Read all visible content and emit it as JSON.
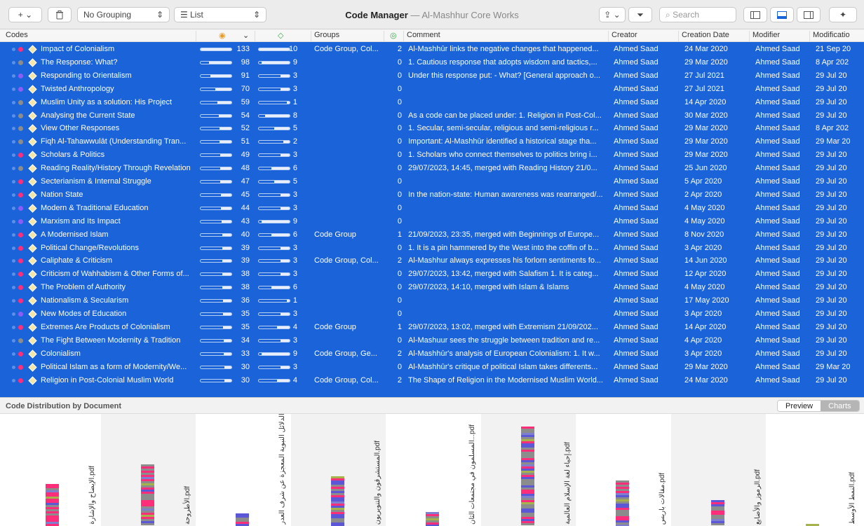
{
  "toolbar": {
    "add_label": "+",
    "grouping_label": "No Grouping",
    "view_label": "List",
    "title": "Code Manager",
    "subtitle": "— Al-Mashhur Core Works",
    "search_placeholder": "Search"
  },
  "columns": {
    "codes": "Codes",
    "groups": "Groups",
    "comment": "Comment",
    "creator": "Creator",
    "creation_date": "Creation Date",
    "modifier": "Modifier",
    "modification": "Modificatio"
  },
  "colors": {
    "selection": "#1a63d8",
    "pink": "#ff2d7a",
    "gray": "#8c8c8c",
    "blue": "#5b57d6",
    "purple": "#8b5cf6"
  },
  "rows": [
    {
      "name": "Impact of Colonialism",
      "dot": "pink",
      "g": 133,
      "d": 10,
      "groups": "Code Group, Col...",
      "gc": "2",
      "comment": "Al-Mashhūr links the negative changes that happened...",
      "creator": "Ahmed Saad",
      "created": "24 Mar 2020",
      "modifier": "Ahmed Saad",
      "modified": "21 Sep 20"
    },
    {
      "name": "The Response: What?",
      "dot": "gray",
      "g": 98,
      "d": 9,
      "groups": "",
      "gc": "0",
      "comment": "1. Cautious response that adopts wisdom and tactics,...",
      "creator": "Ahmed Saad",
      "created": "29 Mar 2020",
      "modifier": "Ahmed Saad",
      "modified": "8 Apr 202"
    },
    {
      "name": "Responding to Orientalism",
      "dot": "purple",
      "g": 91,
      "d": 3,
      "groups": "",
      "gc": "0",
      "comment": "Under this response put: - What? [General approach o...",
      "creator": "Ahmed Saad",
      "created": "27 Jul 2021",
      "modifier": "Ahmed Saad",
      "modified": "29 Jul 20"
    },
    {
      "name": "Twisted Anthropology",
      "dot": "purple",
      "g": 70,
      "d": 3,
      "groups": "",
      "gc": "0",
      "comment": "",
      "creator": "Ahmed Saad",
      "created": "27 Jul 2021",
      "modifier": "Ahmed Saad",
      "modified": "29 Jul 20"
    },
    {
      "name": "Muslim Unity as a solution: His Project",
      "dot": "gray",
      "g": 59,
      "d": 1,
      "groups": "",
      "gc": "0",
      "comment": "",
      "creator": "Ahmed Saad",
      "created": "14 Apr 2020",
      "modifier": "Ahmed Saad",
      "modified": "29 Jul 20"
    },
    {
      "name": "Analysing the Current State",
      "dot": "gray",
      "g": 54,
      "d": 8,
      "groups": "",
      "gc": "0",
      "comment": "As a code can be placed under: 1. Religion in Post-Col...",
      "creator": "Ahmed Saad",
      "created": "30 Mar 2020",
      "modifier": "Ahmed Saad",
      "modified": "29 Jul 20"
    },
    {
      "name": "View Other Responses",
      "dot": "gray",
      "g": 52,
      "d": 5,
      "groups": "",
      "gc": "0",
      "comment": "1. Secular, semi-secular, religious and semi-religious r...",
      "creator": "Ahmed Saad",
      "created": "29 Mar 2020",
      "modifier": "Ahmed Saad",
      "modified": "8 Apr 202"
    },
    {
      "name": "Fiqh Al-Tahawwulāt (Understanding Tran...",
      "dot": "gray",
      "g": 51,
      "d": 2,
      "groups": "",
      "gc": "0",
      "comment": "Important: Al-Mashhūr identified a historical stage tha...",
      "creator": "Ahmed Saad",
      "created": "29 Mar 2020",
      "modifier": "Ahmed Saad",
      "modified": "29 Mar 20"
    },
    {
      "name": "Scholars & Politics",
      "dot": "pink",
      "g": 49,
      "d": 3,
      "groups": "",
      "gc": "0",
      "comment": "1. Scholars who connect themselves to politics bring i...",
      "creator": "Ahmed Saad",
      "created": "29 Mar 2020",
      "modifier": "Ahmed Saad",
      "modified": "29 Jul 20"
    },
    {
      "name": "Reading Reality/History Through Revelation",
      "dot": "gray",
      "g": 48,
      "d": 6,
      "groups": "",
      "gc": "0",
      "comment": "29/07/2023, 14:45, merged with Reading History 21/0...",
      "creator": "Ahmed Saad",
      "created": "25 Jun 2020",
      "modifier": "Ahmed Saad",
      "modified": "29 Jul 20"
    },
    {
      "name": "Secterianism & Internal Struggle",
      "dot": "pink",
      "g": 47,
      "d": 5,
      "groups": "",
      "gc": "0",
      "comment": "",
      "creator": "Ahmed Saad",
      "created": "5 Apr 2020",
      "modifier": "Ahmed Saad",
      "modified": "29 Jul 20"
    },
    {
      "name": "Nation State",
      "dot": "pink",
      "g": 45,
      "d": 3,
      "groups": "",
      "gc": "0",
      "comment": "In the nation-state: Human awareness was rearranged/...",
      "creator": "Ahmed Saad",
      "created": "2 Apr 2020",
      "modifier": "Ahmed Saad",
      "modified": "29 Jul 20"
    },
    {
      "name": "Modern & Traditional Education",
      "dot": "purple",
      "g": 44,
      "d": 3,
      "groups": "",
      "gc": "0",
      "comment": "",
      "creator": "Ahmed Saad",
      "created": "4 May 2020",
      "modifier": "Ahmed Saad",
      "modified": "29 Jul 20"
    },
    {
      "name": "Marxism and Its Impact",
      "dot": "purple",
      "g": 43,
      "d": 9,
      "groups": "",
      "gc": "0",
      "comment": "",
      "creator": "Ahmed Saad",
      "created": "4 May 2020",
      "modifier": "Ahmed Saad",
      "modified": "29 Jul 20"
    },
    {
      "name": "A Modernised Islam",
      "dot": "pink",
      "g": 40,
      "d": 6,
      "groups": "Code Group",
      "gc": "1",
      "comment": "21/09/2023, 23:35, merged with Beginnings of Europe...",
      "creator": "Ahmed Saad",
      "created": "8 Nov 2020",
      "modifier": "Ahmed Saad",
      "modified": "29 Jul 20"
    },
    {
      "name": "Political Change/Revolutions",
      "dot": "pink",
      "g": 39,
      "d": 3,
      "groups": "",
      "gc": "0",
      "comment": "1. It is a pin hammered by the West into the coffin of b...",
      "creator": "Ahmed Saad",
      "created": "3 Apr 2020",
      "modifier": "Ahmed Saad",
      "modified": "29 Jul 20"
    },
    {
      "name": "Caliphate & Criticism",
      "dot": "pink",
      "g": 39,
      "d": 3,
      "groups": "Code Group, Col...",
      "gc": "2",
      "comment": "Al-Mashhur always expresses his forlorn sentiments fo...",
      "creator": "Ahmed Saad",
      "created": "14 Jun 2020",
      "modifier": "Ahmed Saad",
      "modified": "29 Jul 20"
    },
    {
      "name": "Criticism of Wahhabism & Other Forms of...",
      "dot": "pink",
      "g": 38,
      "d": 3,
      "groups": "",
      "gc": "0",
      "comment": "29/07/2023, 13:42, merged with Salafism 1. It is categ...",
      "creator": "Ahmed Saad",
      "created": "12 Apr 2020",
      "modifier": "Ahmed Saad",
      "modified": "29 Jul 20"
    },
    {
      "name": "The Problem of Authority",
      "dot": "pink",
      "g": 38,
      "d": 6,
      "groups": "",
      "gc": "0",
      "comment": "29/07/2023, 14:10, merged with Islam & Islams",
      "creator": "Ahmed Saad",
      "created": "4 May 2020",
      "modifier": "Ahmed Saad",
      "modified": "29 Jul 20"
    },
    {
      "name": "Nationalism & Secularism",
      "dot": "pink",
      "g": 36,
      "d": 1,
      "groups": "",
      "gc": "0",
      "comment": "",
      "creator": "Ahmed Saad",
      "created": "17 May 2020",
      "modifier": "Ahmed Saad",
      "modified": "29 Jul 20"
    },
    {
      "name": "New Modes of Education",
      "dot": "purple",
      "g": 35,
      "d": 3,
      "groups": "",
      "gc": "0",
      "comment": "",
      "creator": "Ahmed Saad",
      "created": "3 Apr 2020",
      "modifier": "Ahmed Saad",
      "modified": "29 Jul 20"
    },
    {
      "name": "Extremes Are Products of Colonialism",
      "dot": "pink",
      "g": 35,
      "d": 4,
      "groups": "Code Group",
      "gc": "1",
      "comment": "29/07/2023, 13:02, merged with Extremism 21/09/202...",
      "creator": "Ahmed Saad",
      "created": "14 Apr 2020",
      "modifier": "Ahmed Saad",
      "modified": "29 Jul 20"
    },
    {
      "name": "The Fight Between Modernity & Tradition",
      "dot": "gray",
      "g": 34,
      "d": 3,
      "groups": "",
      "gc": "0",
      "comment": "Al-Mashuur sees the struggle between tradition and re...",
      "creator": "Ahmed Saad",
      "created": "4 Apr 2020",
      "modifier": "Ahmed Saad",
      "modified": "29 Jul 20"
    },
    {
      "name": "Colonialism",
      "dot": "pink",
      "g": 33,
      "d": 9,
      "groups": "Code Group, Ge...",
      "gc": "2",
      "comment": "Al-Mashhūr's analysis of European Colonialism: 1. It w...",
      "creator": "Ahmed Saad",
      "created": "3 Apr 2020",
      "modifier": "Ahmed Saad",
      "modified": "29 Jul 20"
    },
    {
      "name": "Political Islam as a form of Modernity/We...",
      "dot": "pink",
      "g": 30,
      "d": 3,
      "groups": "",
      "gc": "0",
      "comment": "Al-Mashhūr's critique of political Islam takes differents...",
      "creator": "Ahmed Saad",
      "created": "29 Mar 2020",
      "modifier": "Ahmed Saad",
      "modified": "29 Mar 20"
    },
    {
      "name": "Religion in Post-Colonial Muslim World",
      "dot": "pink",
      "g": 30,
      "d": 4,
      "groups": "Code Group, Col...",
      "gc": "2",
      "comment": "The Shape of Religion in the Modernised Muslim World...",
      "creator": "Ahmed Saad",
      "created": "24 Mar 2020",
      "modifier": "Ahmed Saad",
      "modified": "29 Jul 20"
    }
  ],
  "chart_section": {
    "title": "Code Distribution by Document",
    "preview_label": "Preview",
    "charts_label": "Charts"
  },
  "documents": [
    {
      "label": "الإيضاح والإشارة.pdf",
      "total": 0.42,
      "mix": [
        "pink",
        "pink",
        "gray",
        "pink"
      ]
    },
    {
      "label": "الأطروحة.pdf",
      "total": 0.62,
      "mix": [
        "pink",
        "gray",
        "pink",
        "gray"
      ]
    },
    {
      "label": "الدلائل النبوية المعجزة عن شرف العدر...",
      "total": 0.13,
      "mix": [
        "gray",
        "blue",
        "pink",
        "gray"
      ]
    },
    {
      "label": "المستشرقون والتنويريون.pdf",
      "total": 0.5,
      "mix": [
        "blue",
        "blue",
        "pink",
        "gray"
      ]
    },
    {
      "label": "المسلمون في مجتمعات الثان...pdf",
      "total": 0.14,
      "mix": [
        "gray",
        "pink",
        "gray",
        "pink"
      ]
    },
    {
      "label": "إحياء لغة الإسلام العالمية.pdf",
      "total": 1.0,
      "mix": [
        "gray",
        "blue",
        "pink",
        "gray"
      ]
    },
    {
      "label": "مقالات باريس.pdf",
      "total": 0.46,
      "mix": [
        "gray",
        "pink",
        "gray",
        "blue"
      ]
    },
    {
      "label": "الرموز والأضابع.pdf",
      "total": 0.26,
      "mix": [
        "gray",
        "blue",
        "pink",
        "gray"
      ]
    },
    {
      "label": "النمط الأوسط.pdf",
      "total": 0.02,
      "mix": [
        "pink",
        "gray",
        "pink",
        "gray"
      ]
    }
  ]
}
